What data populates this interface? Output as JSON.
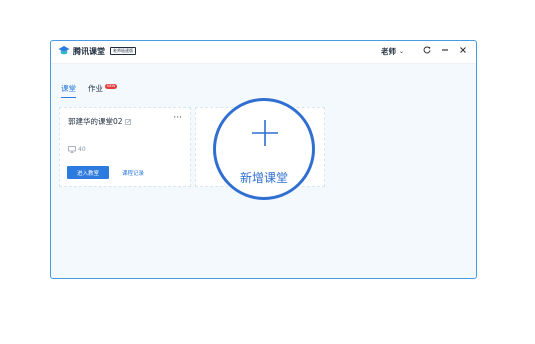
{
  "titlebar": {
    "app_name": "腾讯课堂",
    "edition_badge": "老师极速版",
    "user_role": "老师",
    "user_menu_icon": "chevron-down-icon",
    "refresh_icon": "refresh-icon",
    "minimize_icon": "minimize-icon",
    "close_icon": "close-icon"
  },
  "tabs": [
    {
      "label": "课堂",
      "active": true
    },
    {
      "label": "作业",
      "badge": "NEW",
      "active": false
    }
  ],
  "class_card": {
    "name": "郭建华的课堂02",
    "student_count": "40",
    "enter_button": "进入教室",
    "record_link": "课程记录",
    "more": "···"
  },
  "add_class": {
    "label": "新增课堂",
    "icon": "plus-icon"
  },
  "colors": {
    "accent": "#2e7be0",
    "highlight": "#2f6fd1",
    "badge": "#e23b3b",
    "window_bg": "#f3f9fd"
  }
}
